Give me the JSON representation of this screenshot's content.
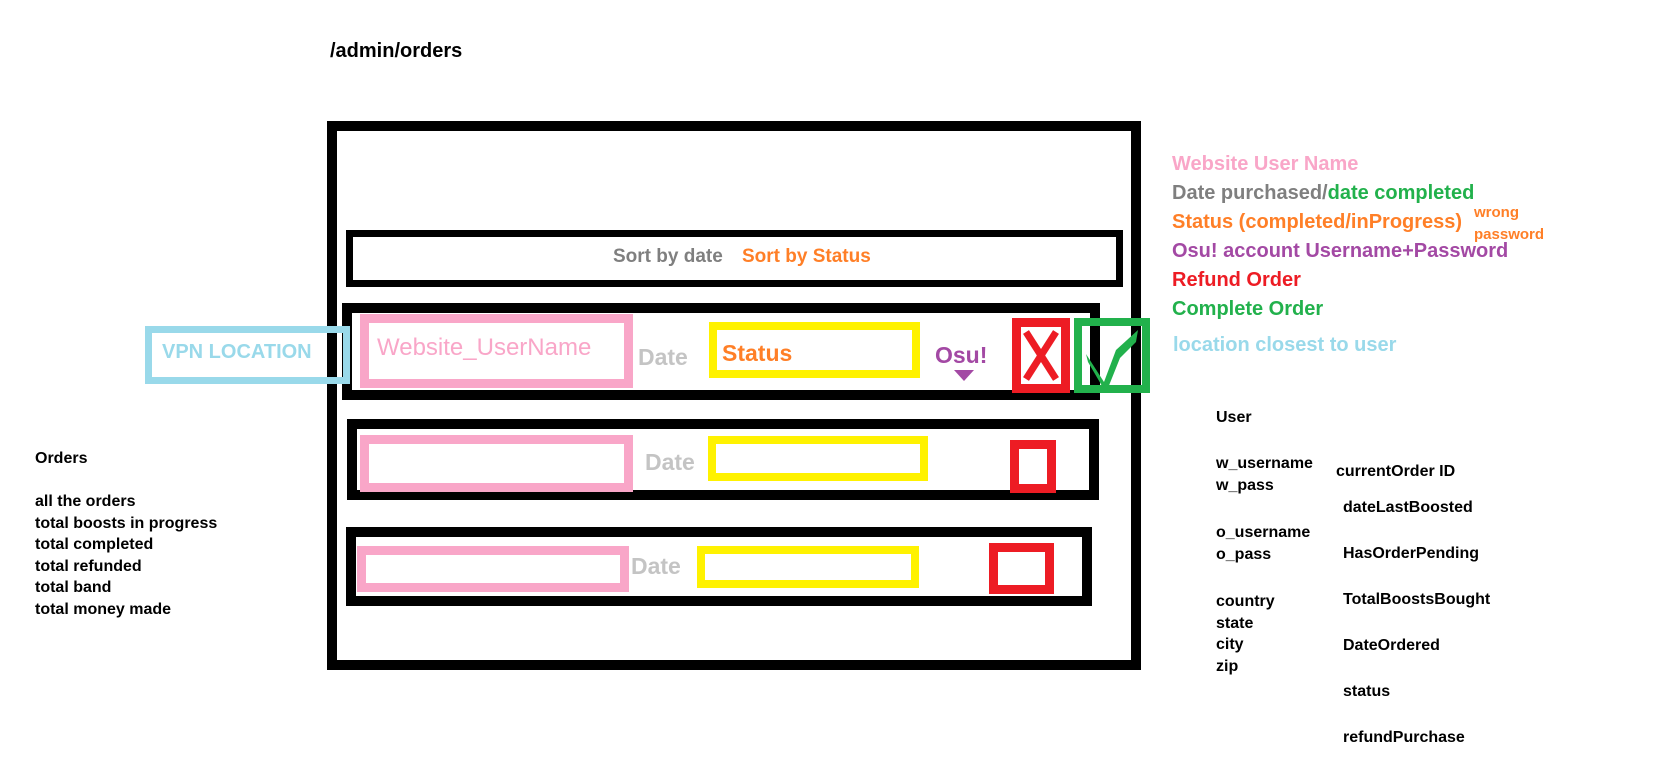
{
  "page": {
    "route": "/admin/orders"
  },
  "sort_bar": {
    "by_date": "Sort by date",
    "by_status": "Sort by Status"
  },
  "rows": [
    {
      "username": "Website_UserName",
      "date": "Date",
      "status": "Status",
      "osu": "Osu!"
    },
    {
      "username": "",
      "date": "Date",
      "status": ""
    },
    {
      "username": "",
      "date": "Date",
      "status": ""
    }
  ],
  "vpn": {
    "label": "VPN LOCATION"
  },
  "legend": {
    "website_user_name": "Website User Name",
    "date_purchased": "Date purchased/",
    "date_completed": "date completed",
    "status": "Status (completed/inProgress)",
    "status_note_1": "wrong",
    "status_note_2": "password",
    "osu_account": "Osu! account Username+Password",
    "refund_order": "Refund Order",
    "complete_order": "Complete Order",
    "location": "location closest to user"
  },
  "orders_panel": {
    "title": "Orders",
    "items": [
      "all the orders",
      "total boosts in progress",
      "total completed",
      "total refunded",
      "total band",
      "total money made"
    ]
  },
  "user_model": {
    "title": "User",
    "fields_a": [
      "w_username",
      "w_pass"
    ],
    "fields_b": [
      "o_username",
      "o_pass"
    ],
    "fields_c": [
      "country",
      "state",
      "city",
      "zip"
    ],
    "right_fields": {
      "current_order_id": "currentOrder ID",
      "date_last_boosted": "dateLastBoosted",
      "has_order_pending": "HasOrderPending",
      "total_boosts_bought": "TotalBoostsBought",
      "date_ordered": "DateOrdered",
      "status": "status",
      "refund_purchase": "refundPurchase"
    }
  },
  "colors": {
    "pink": "#f9a6c8",
    "yellow": "#fff200",
    "red": "#ed1c24",
    "green": "#22b14c",
    "orange": "#ff7f27",
    "purple": "#a349a4",
    "sky": "#99d9ea",
    "gray": "#7f7f7f",
    "light_gray": "#c4c4c4"
  },
  "icons": {
    "refund": "x-icon",
    "complete": "checkmark-icon",
    "osu_dropdown": "triangle-down-icon"
  }
}
